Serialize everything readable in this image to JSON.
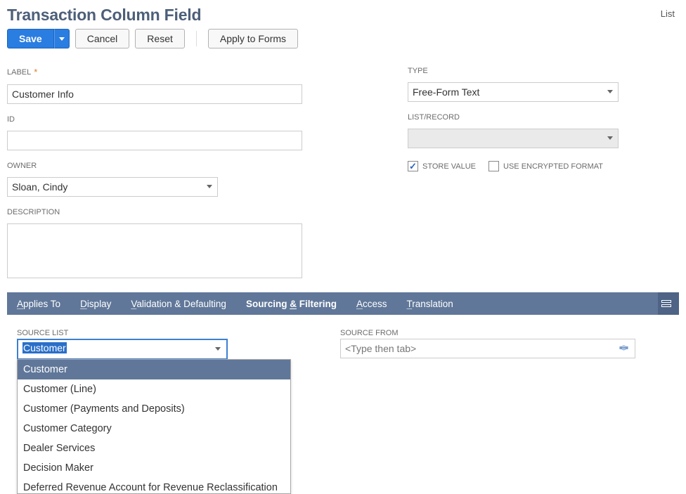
{
  "header": {
    "title": "Transaction Column Field",
    "list_link": "List"
  },
  "toolbar": {
    "save": "Save",
    "cancel": "Cancel",
    "reset": "Reset",
    "apply_to_forms": "Apply to Forms"
  },
  "left": {
    "label_label": "LABEL",
    "label_value": "Customer Info",
    "id_label": "ID",
    "id_value": "",
    "owner_label": "OWNER",
    "owner_value": "Sloan, Cindy",
    "description_label": "DESCRIPTION",
    "description_value": ""
  },
  "right": {
    "type_label": "TYPE",
    "type_value": "Free-Form Text",
    "listrecord_label": "LIST/RECORD",
    "listrecord_value": "",
    "store_value_label": "STORE VALUE",
    "use_encrypted_label": "USE ENCRYPTED FORMAT"
  },
  "tabs": {
    "applies_to": "pplies To",
    "applies_to_pre": "A",
    "display": "isplay",
    "display_pre": "D",
    "validation": "alidation & Defaulting",
    "validation_pre": "V",
    "sourcing_pre": "Sourcing ",
    "sourcing_u": "&",
    "sourcing_post": " Filtering",
    "access": "ccess",
    "access_pre": "A",
    "translation": "ranslation",
    "translation_pre": "T"
  },
  "sourcing": {
    "source_list_label": "SOURCE LIST",
    "source_list_value": "Customer",
    "source_from_label": "SOURCE FROM",
    "source_from_placeholder": "<Type then tab>",
    "options": [
      "Customer",
      "Customer (Line)",
      "Customer (Payments and Deposits)",
      "Customer Category",
      "Dealer Services",
      "Decision Maker",
      "Deferred Revenue Account for Revenue Reclassification"
    ]
  }
}
